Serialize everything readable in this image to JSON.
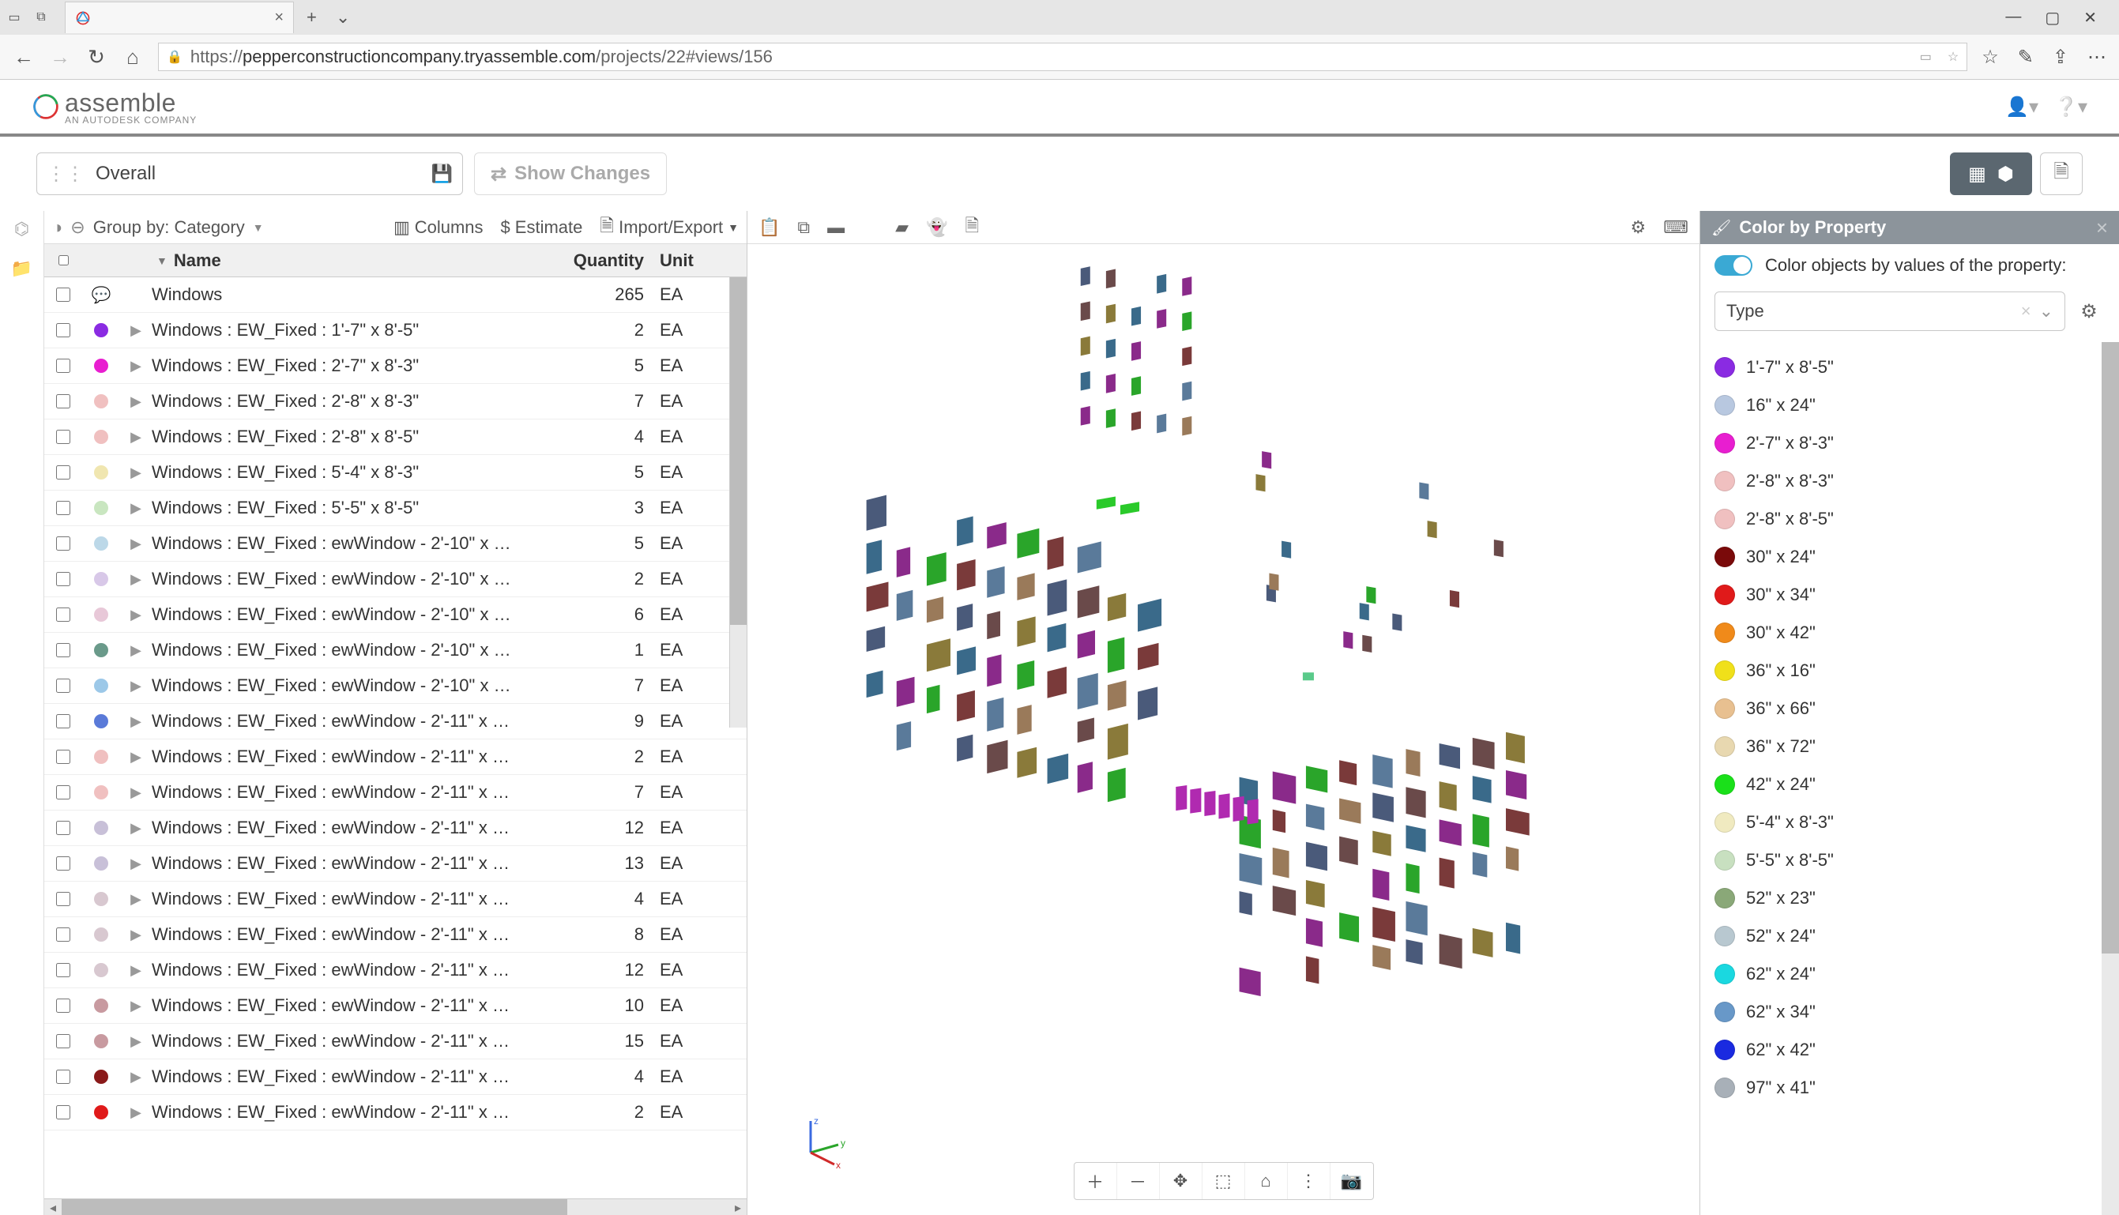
{
  "browser": {
    "tab_title": "",
    "url_prefix": "https://",
    "url_host": "pepperconstructioncompany.tryassemble.com",
    "url_path": "/projects/22#views/156"
  },
  "logo": {
    "name": "assemble",
    "sub": "AN AUTODESK COMPANY"
  },
  "toolbar": {
    "view_name": "Overall",
    "show_changes": "Show Changes"
  },
  "grid": {
    "group_by_label": "Group by: Category",
    "columns_label": "Columns",
    "estimate_label": "Estimate",
    "import_export_label": "Import/Export",
    "header": {
      "name": "Name",
      "quantity": "Quantity",
      "unit": "Unit"
    },
    "group": {
      "name": "Windows",
      "qty": "265",
      "unit": "EA",
      "has_comment": true
    },
    "rows": [
      {
        "color": "#8a2be2",
        "name": "Windows : EW_Fixed : 1'-7\" x 8'-5\"",
        "qty": "2",
        "unit": "EA"
      },
      {
        "color": "#e81ed0",
        "name": "Windows : EW_Fixed : 2'-7\" x 8'-3\"",
        "qty": "5",
        "unit": "EA"
      },
      {
        "color": "#f0c0c0",
        "name": "Windows : EW_Fixed : 2'-8\" x 8'-3\"",
        "qty": "7",
        "unit": "EA"
      },
      {
        "color": "#f0c0c0",
        "name": "Windows : EW_Fixed : 2'-8\" x 8'-5\"",
        "qty": "4",
        "unit": "EA"
      },
      {
        "color": "#f0e6b0",
        "name": "Windows : EW_Fixed : 5'-4\" x 8'-3\"",
        "qty": "5",
        "unit": "EA"
      },
      {
        "color": "#c9e6c0",
        "name": "Windows : EW_Fixed : 5'-5\" x 8'-5\"",
        "qty": "3",
        "unit": "EA"
      },
      {
        "color": "#bcd8e8",
        "name": "Windows : EW_Fixed : ewWindow - 2'-10\" x …",
        "qty": "5",
        "unit": "EA"
      },
      {
        "color": "#d8c8e8",
        "name": "Windows : EW_Fixed : ewWindow - 2'-10\" x …",
        "qty": "2",
        "unit": "EA"
      },
      {
        "color": "#e8c8d8",
        "name": "Windows : EW_Fixed : ewWindow - 2'-10\" x …",
        "qty": "6",
        "unit": "EA"
      },
      {
        "color": "#6a9a8a",
        "name": "Windows : EW_Fixed : ewWindow - 2'-10\" x …",
        "qty": "1",
        "unit": "EA"
      },
      {
        "color": "#9cc8e8",
        "name": "Windows : EW_Fixed : ewWindow - 2'-10\" x …",
        "qty": "7",
        "unit": "EA"
      },
      {
        "color": "#5a7ad8",
        "name": "Windows : EW_Fixed : ewWindow - 2'-11\" x …",
        "qty": "9",
        "unit": "EA"
      },
      {
        "color": "#f0c0c0",
        "name": "Windows : EW_Fixed : ewWindow - 2'-11\" x …",
        "qty": "2",
        "unit": "EA"
      },
      {
        "color": "#f0c0c0",
        "name": "Windows : EW_Fixed : ewWindow - 2'-11\" x …",
        "qty": "7",
        "unit": "EA"
      },
      {
        "color": "#c8c0d8",
        "name": "Windows : EW_Fixed : ewWindow - 2'-11\" x …",
        "qty": "12",
        "unit": "EA"
      },
      {
        "color": "#c8c0d8",
        "name": "Windows : EW_Fixed : ewWindow - 2'-11\" x …",
        "qty": "13",
        "unit": "EA"
      },
      {
        "color": "#d8c8d0",
        "name": "Windows : EW_Fixed : ewWindow - 2'-11\" x …",
        "qty": "4",
        "unit": "EA"
      },
      {
        "color": "#d8c8d0",
        "name": "Windows : EW_Fixed : ewWindow - 2'-11\" x …",
        "qty": "8",
        "unit": "EA"
      },
      {
        "color": "#d8c8d0",
        "name": "Windows : EW_Fixed : ewWindow - 2'-11\" x …",
        "qty": "12",
        "unit": "EA"
      },
      {
        "color": "#c89aa0",
        "name": "Windows : EW_Fixed : ewWindow - 2'-11\" x …",
        "qty": "10",
        "unit": "EA"
      },
      {
        "color": "#c89aa0",
        "name": "Windows : EW_Fixed : ewWindow - 2'-11\" x …",
        "qty": "15",
        "unit": "EA"
      },
      {
        "color": "#8a1a1a",
        "name": "Windows : EW_Fixed : ewWindow - 2'-11\" x …",
        "qty": "4",
        "unit": "EA"
      },
      {
        "color": "#e01a1a",
        "name": "Windows : EW_Fixed : ewWindow - 2'-11\" x …",
        "qty": "2",
        "unit": "EA"
      }
    ]
  },
  "color_panel": {
    "title": "Color by Property",
    "toggle_label": "Color objects by values of the property:",
    "select_value": "Type",
    "legend": [
      {
        "color": "#8a2be2",
        "label": "1'-7\" x 8'-5\""
      },
      {
        "color": "#b8c8e0",
        "label": "16\" x 24\""
      },
      {
        "color": "#e81ed0",
        "label": "2'-7\" x 8'-3\""
      },
      {
        "color": "#f0c0c0",
        "label": "2'-8\" x 8'-3\""
      },
      {
        "color": "#f0c0c0",
        "label": "2'-8\" x 8'-5\""
      },
      {
        "color": "#7a0a0a",
        "label": "30\" x 24\""
      },
      {
        "color": "#e01a1a",
        "label": "30\" x 34\""
      },
      {
        "color": "#f08a1a",
        "label": "30\" x 42\""
      },
      {
        "color": "#f0e01a",
        "label": "36\" x 16\""
      },
      {
        "color": "#e8c090",
        "label": "36\" x 66\""
      },
      {
        "color": "#e8d8b0",
        "label": "36\" x 72\""
      },
      {
        "color": "#1ae01a",
        "label": "42\" x 24\""
      },
      {
        "color": "#f0eac0",
        "label": "5'-4\" x 8'-3\""
      },
      {
        "color": "#c8e0c0",
        "label": "5'-5\" x 8'-5\""
      },
      {
        "color": "#8aa878",
        "label": "52\" x 23\""
      },
      {
        "color": "#b8c8d0",
        "label": "52\" x 24\""
      },
      {
        "color": "#1ad8e0",
        "label": "62\" x 24\""
      },
      {
        "color": "#6898c8",
        "label": "62\" x 34\""
      },
      {
        "color": "#1a2ae0",
        "label": "62\" x 42\""
      },
      {
        "color": "#a8b0b8",
        "label": "97\" x 41\""
      }
    ]
  }
}
